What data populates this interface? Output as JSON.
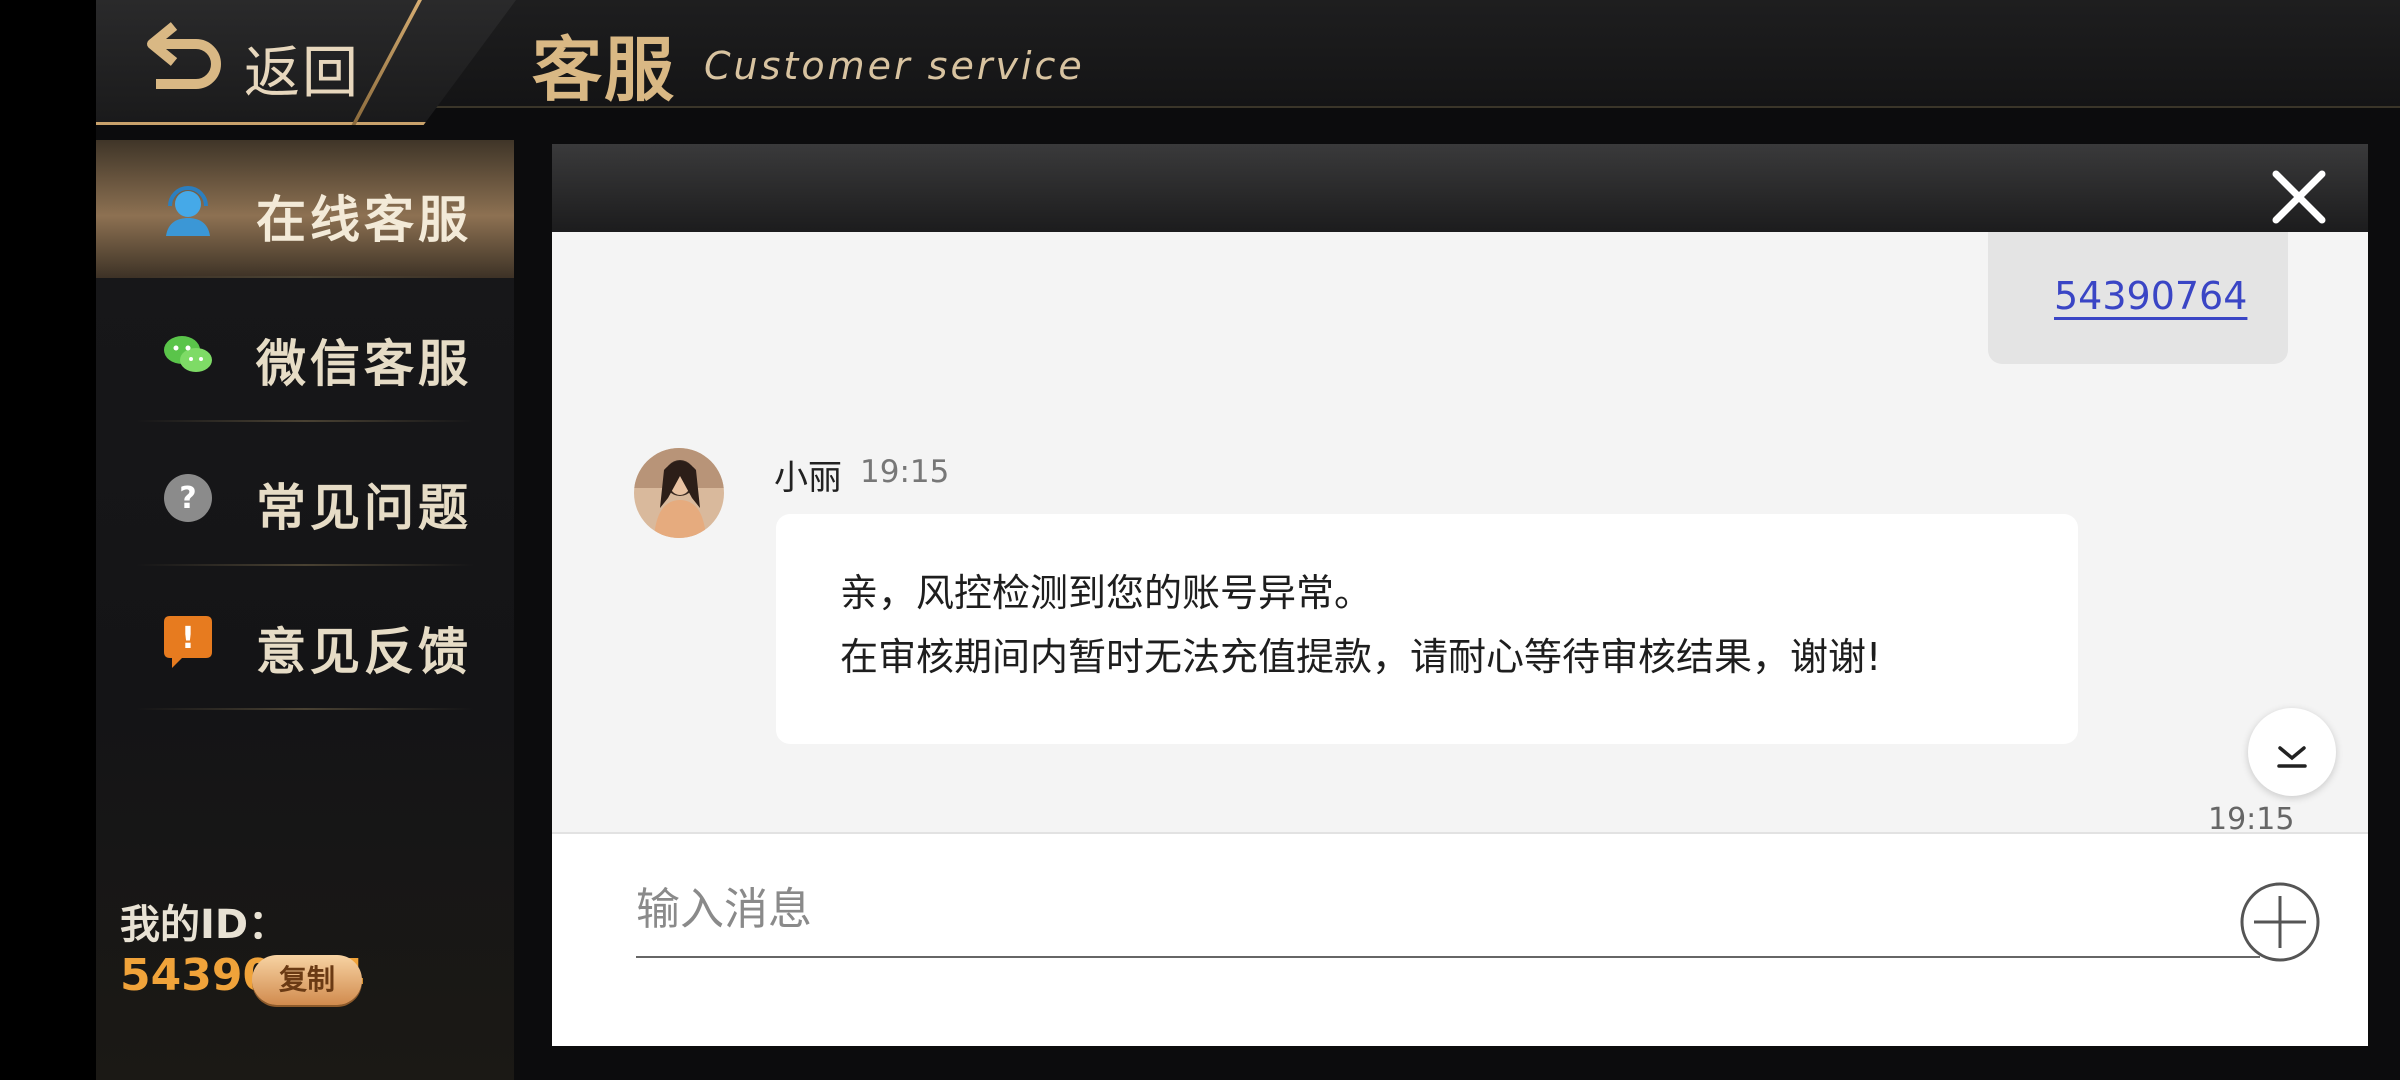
{
  "header": {
    "back_label": "返回",
    "title_cn": "客服",
    "title_en": "Customer service"
  },
  "sidebar": {
    "items": [
      {
        "label": "在线客服",
        "icon": "headset-icon",
        "active": true
      },
      {
        "label": "微信客服",
        "icon": "wechat-icon",
        "active": false
      },
      {
        "label": "常见问题",
        "icon": "question-icon",
        "active": false
      },
      {
        "label": "意见反馈",
        "icon": "feedback-icon",
        "active": false
      }
    ],
    "my_id_label": "我的ID：",
    "my_id_value": "54390764",
    "copy_label": "复制"
  },
  "chat": {
    "outgoing_message": "54390764",
    "incoming": {
      "sender": "小丽",
      "time": "19:15",
      "lines": [
        "亲，风控检测到您的账号异常。",
        "在审核期间内暂时无法充值提款，请耐心等待审核结果，谢谢!"
      ]
    },
    "bottom_time": "19:15",
    "input_placeholder": "输入消息"
  },
  "colors": {
    "accent_gold": "#d9b884",
    "id_orange": "#f0a33a",
    "link_blue": "#3a45c5"
  }
}
